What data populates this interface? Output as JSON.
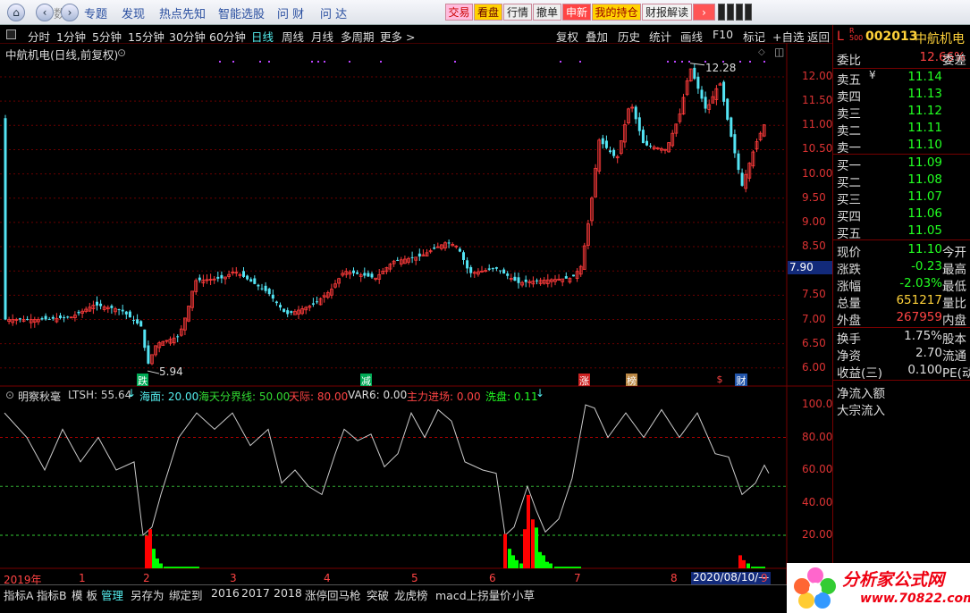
{
  "toolbar": {
    "menus": [
      "专题",
      "发现",
      "热点先知",
      "智能选股",
      "问 财",
      "问 达"
    ],
    "buttons": [
      "交易",
      "看盘",
      "行情",
      "撤单",
      "申新",
      "我的持仓",
      "财报解读"
    ],
    "back_char": "数"
  },
  "periods": [
    "分时",
    "1分钟",
    "5分钟",
    "15分钟",
    "30分钟",
    "60分钟",
    "日线",
    "周线",
    "月线",
    "多周期",
    "更多 >"
  ],
  "tools": [
    "复权",
    "叠加",
    "历史",
    "统计",
    "画线",
    "F10",
    "标记",
    "+自选",
    "返回"
  ],
  "chart": {
    "title": "中航机电(日线,前复权)",
    "high_label": "12.28",
    "low_label": "5.94",
    "price_ticks": [
      "12.00",
      "11.50",
      "11.00",
      "10.50",
      "10.00",
      "9.50",
      "9.00",
      "8.50",
      "8.00",
      "7.50",
      "7.00",
      "6.50",
      "6.00"
    ],
    "current_price_box": "7.90",
    "markers": [
      "跌",
      "减",
      "涨",
      "榜",
      "$",
      "财"
    ]
  },
  "indicator": {
    "name": "明察秋毫",
    "ltsh": "LTSH: 55.64",
    "haimian": "海面: 20.00",
    "haitian": "海天分界线: 50.00",
    "tianji": "天际: 80.00",
    "var6": "VAR6: 0.00",
    "zhuli": "主力进场: 0.00",
    "xipan": "洗盘: 0.11",
    "ticks": [
      "100.0",
      "80.00",
      "60.00",
      "40.00",
      "20.00"
    ]
  },
  "timeline": {
    "year": "2019年",
    "months": [
      "1",
      "2",
      "3",
      "4",
      "5",
      "6",
      "7",
      "8"
    ],
    "date": "2020/08/10/—",
    "last": "9"
  },
  "quote": {
    "code": "002013",
    "name": "中航机电",
    "weibi_label": "委比",
    "weibi": "12.66%",
    "weicha": "委差",
    "sell": [
      {
        "n": "卖五",
        "p": "11.14"
      },
      {
        "n": "卖四",
        "p": "11.13"
      },
      {
        "n": "卖三",
        "p": "11.12"
      },
      {
        "n": "卖二",
        "p": "11.11"
      },
      {
        "n": "卖一",
        "p": "11.10"
      }
    ],
    "buy": [
      {
        "n": "买一",
        "p": "11.09"
      },
      {
        "n": "买二",
        "p": "11.08"
      },
      {
        "n": "买三",
        "p": "11.07"
      },
      {
        "n": "买四",
        "p": "11.06"
      },
      {
        "n": "买五",
        "p": "11.05"
      }
    ],
    "stats": [
      {
        "n": "现价",
        "v": "11.10",
        "x": "今开"
      },
      {
        "n": "涨跌",
        "v": "-0.23",
        "x": "最高"
      },
      {
        "n": "涨幅",
        "v": "-2.03%",
        "x": "最低"
      },
      {
        "n": "总量",
        "v": "651217",
        "x": "量比"
      },
      {
        "n": "外盘",
        "v": "267959",
        "x": "内盘"
      }
    ],
    "stats2": [
      {
        "n": "换手",
        "v": "1.75%",
        "x": "股本"
      },
      {
        "n": "净资",
        "v": "2.70",
        "x": "流通"
      },
      {
        "n": "收益(三)",
        "v": "0.100",
        "x": "PE(动"
      }
    ],
    "flow1": "净流入额",
    "flow2": "大宗流入"
  },
  "tabs": [
    "指标A",
    "指标B",
    "模 板",
    "管理",
    "另存为",
    "绑定到",
    "2016",
    "2017",
    "2018",
    "涨停回马枪",
    "突破",
    "龙虎榜",
    "macd上拐量价",
    "小草"
  ],
  "watermark": {
    "title": "分析家公式网",
    "url": "www.70822.com"
  },
  "colors": {
    "up": "#ff3b3b",
    "down": "#54e4f4",
    "grid": "#6a0000",
    "yellow": "#ffd23a",
    "green": "#2bff4a"
  }
}
